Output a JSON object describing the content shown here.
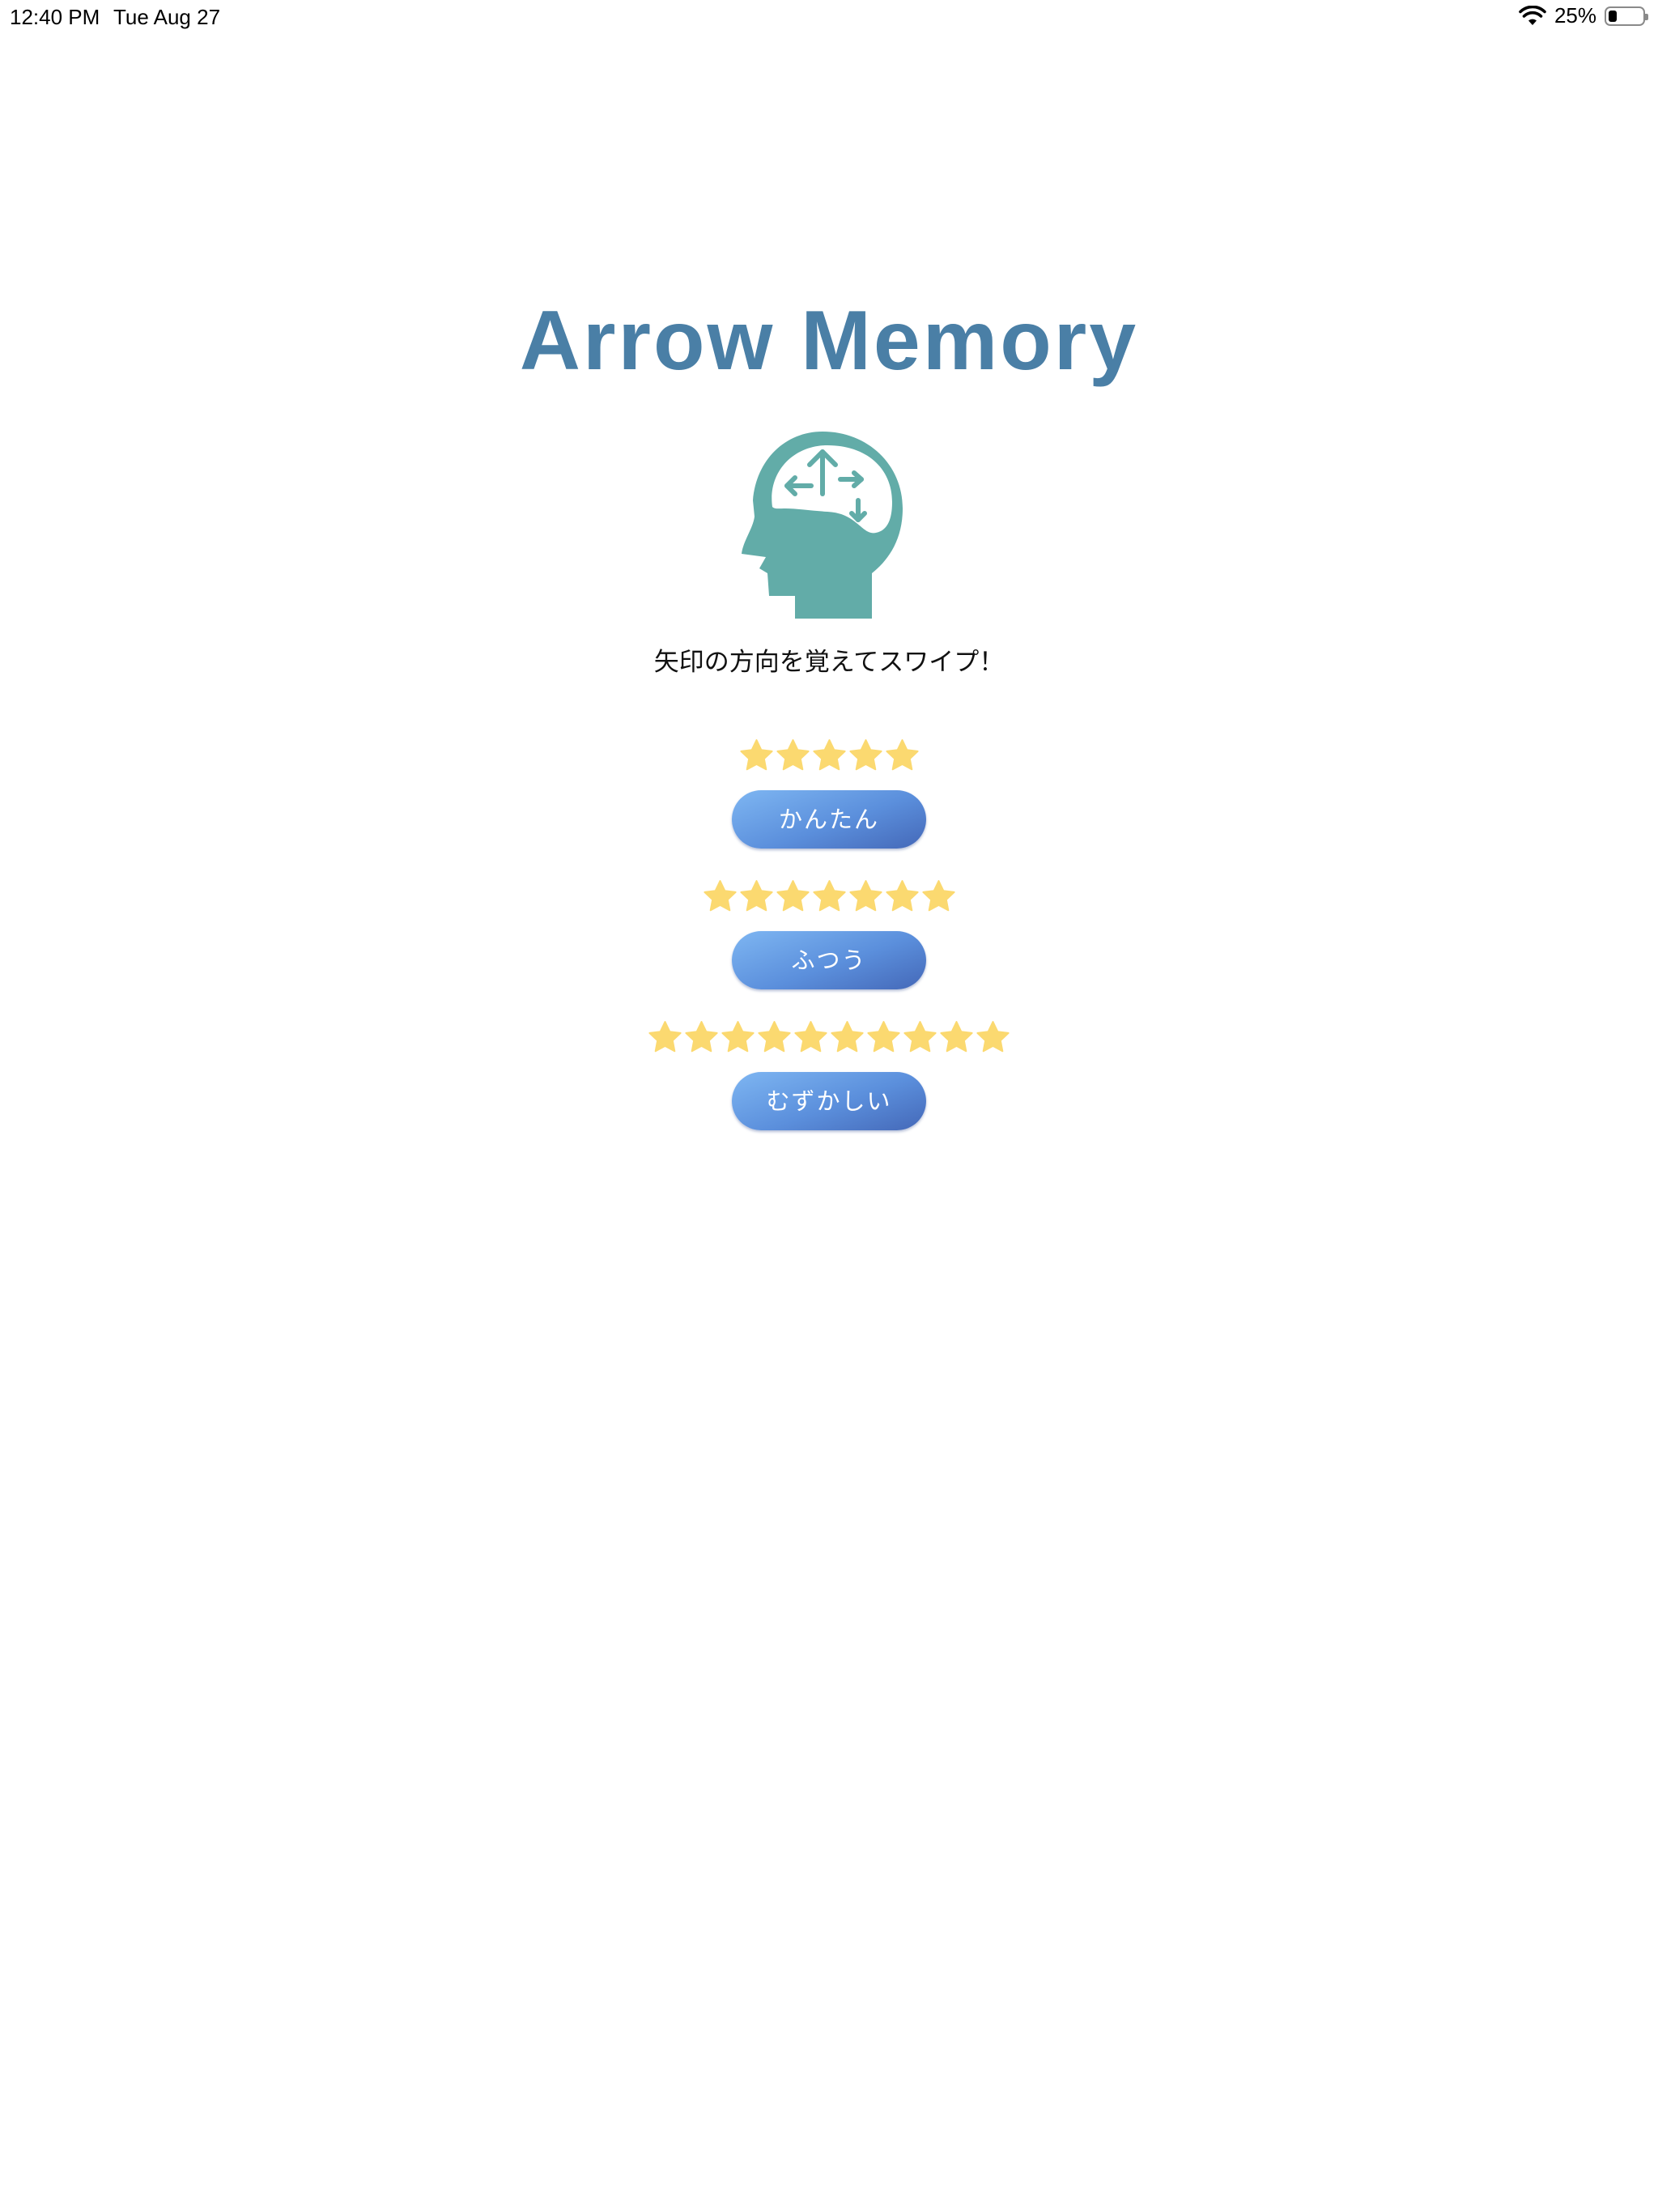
{
  "status_bar": {
    "time": "12:40 PM",
    "date": "Tue Aug 27",
    "battery_percent": "25%",
    "battery_level": 0.25,
    "icons": [
      "wifi-icon",
      "battery-icon"
    ]
  },
  "app": {
    "title": "Arrow Memory",
    "logo_icon": "brain-arrows-head-icon",
    "subtitle": "矢印の方向を覚えてスワイプ！"
  },
  "colors": {
    "title": "#4a7fa6",
    "logo": "#62aca8",
    "star": "#fbd970",
    "button_gradient_top": "#7eb6f2",
    "button_gradient_bottom": "#4468b8",
    "button_text": "#ffffff"
  },
  "levels": [
    {
      "label": "かんたん",
      "stars": 5
    },
    {
      "label": "ふつう",
      "stars": 7
    },
    {
      "label": "むずかしい",
      "stars": 10
    }
  ]
}
